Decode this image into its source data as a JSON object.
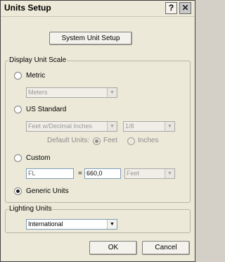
{
  "window": {
    "title": "Units Setup",
    "help_glyph": "?",
    "close_glyph": "✕"
  },
  "system_unit_setup_label": "System Unit Setup",
  "display_unit_scale": {
    "group_label": "Display Unit Scale",
    "metric": {
      "label": "Metric",
      "selected": false,
      "combo_value": "Meters"
    },
    "us_standard": {
      "label": "US Standard",
      "selected": false,
      "combo_value": "Feet w/Decimal Inches",
      "fraction_value": "1/8",
      "default_units_label": "Default Units:",
      "feet_label": "Feet",
      "inches_label": "Inches",
      "default_units_selected": "Feet"
    },
    "custom": {
      "label": "Custom",
      "selected": false,
      "name_value": "FL",
      "equals": "=",
      "amount_value": "660,0",
      "units_value": "Feet"
    },
    "generic": {
      "label": "Generic Units",
      "selected": true
    }
  },
  "lighting_units": {
    "group_label": "Lighting Units",
    "value": "International"
  },
  "ok_label": "OK",
  "cancel_label": "Cancel",
  "icons": {
    "dropdown": "▼"
  }
}
